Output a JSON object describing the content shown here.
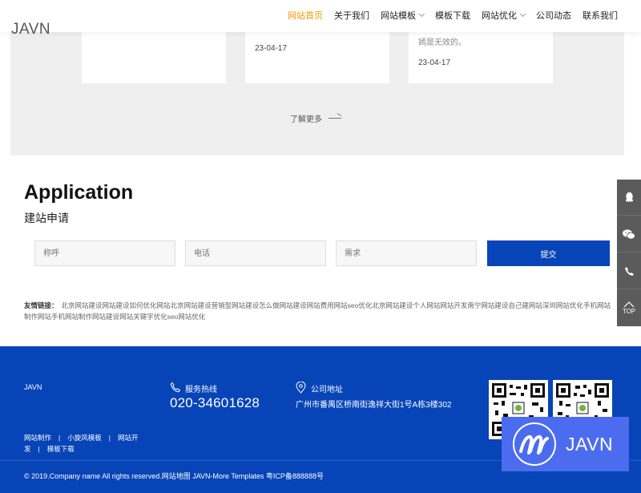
{
  "header": {
    "logo": "JAVN",
    "nav": [
      {
        "label": "网站首页",
        "active": true,
        "dropdown": false
      },
      {
        "label": "关于我们",
        "active": false,
        "dropdown": false
      },
      {
        "label": "网站模板",
        "active": false,
        "dropdown": true
      },
      {
        "label": "模板下载",
        "active": false,
        "dropdown": false
      },
      {
        "label": "网站优化",
        "active": false,
        "dropdown": true
      },
      {
        "label": "公司动态",
        "active": false,
        "dropdown": false
      },
      {
        "label": "联系我们",
        "active": false,
        "dropdown": false
      }
    ]
  },
  "news": {
    "cards": [
      {
        "excerpt": "",
        "date": ""
      },
      {
        "excerpt": "",
        "date": "23-04-17"
      },
      {
        "excerpt": "嫣是无效的。",
        "date": "23-04-17"
      }
    ],
    "more_label": "了解更多"
  },
  "application": {
    "title": "Application",
    "subtitle": "建站申请",
    "fields": {
      "name_placeholder": "称呼",
      "phone_placeholder": "电话",
      "need_placeholder": "需求"
    },
    "submit_label": "提交"
  },
  "friend_links": {
    "label": "友情链接：",
    "items": [
      "北京网站建设",
      "网站建设如何优化",
      "网站",
      "北京网站建设",
      "营销型网站建设",
      "怎么做网站建设",
      "网站费用",
      "网站seo优化",
      "北京网站建设",
      "个人网站",
      "网站开发",
      "南宁网站建设",
      "自己建网站",
      "深圳网站优化",
      "手机网站制作",
      "网站",
      "手机网站制作",
      "网站建设",
      "网站关键字优化",
      "seo网站优化"
    ]
  },
  "float_bar": {
    "items": [
      {
        "icon": "qq-icon"
      },
      {
        "icon": "wechat-icon"
      },
      {
        "icon": "phone-icon"
      },
      {
        "icon": "top-icon",
        "label": "TOP"
      }
    ]
  },
  "footer": {
    "brand": "JAVN",
    "hotline_label": "服务热线",
    "hotline": "020-34601628",
    "address_label": "公司地址",
    "address": "广州市番禺区桥南街逸祥大街1号A栋3楼302",
    "links": [
      "网站制作",
      "小旋风模板",
      "网站开发",
      "模板下载"
    ],
    "copyright": "© 2019.Company name All rights reserved.网站地图 JAVN-More Templates 粤ICP备888888号"
  },
  "badge": {
    "text": "JAVN"
  },
  "colors": {
    "accent": "#f39800",
    "brand_blue": "#0744b7",
    "badge_blue": "#4c6cf0",
    "sidebar": "#5b5b5b"
  }
}
